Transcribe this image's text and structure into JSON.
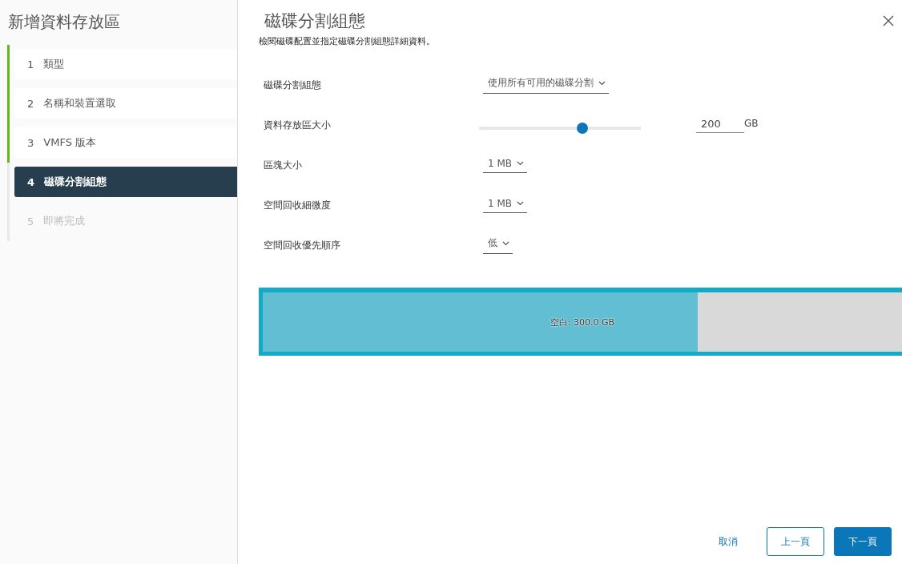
{
  "sidebar": {
    "title": "新增資料存放區",
    "steps": [
      {
        "number": "1",
        "label": "類型",
        "selected": false,
        "done": true,
        "disabled": false
      },
      {
        "number": "2",
        "label": "名稱和裝置選取",
        "selected": false,
        "done": true,
        "disabled": false
      },
      {
        "number": "3",
        "label": "VMFS 版本",
        "selected": false,
        "done": true,
        "disabled": false
      },
      {
        "number": "4",
        "label": "磁碟分割組態",
        "selected": true,
        "done": false,
        "disabled": false
      },
      {
        "number": "5",
        "label": "即將完成",
        "selected": false,
        "done": false,
        "disabled": true
      }
    ]
  },
  "main": {
    "title": "磁碟分割組態",
    "description": "檢閱磁碟配置並指定磁碟分割組態詳細資料。",
    "fields": [
      {
        "kind": "select",
        "label": "磁碟分割組態",
        "value": "使用所有可用的磁碟分割"
      },
      {
        "kind": "slider",
        "label": "資料存放區大小",
        "level": 0.65,
        "value": "200",
        "unit": "GB"
      },
      {
        "kind": "select",
        "label": "區塊大小",
        "value": "1 MB"
      },
      {
        "kind": "select",
        "label": "空間回收細微度",
        "value": "1 MB"
      },
      {
        "kind": "select",
        "label": "空間回收優先順序",
        "value": "低"
      }
    ],
    "partition": {
      "label": "空白: 300.0 GB",
      "level": 0.68
    }
  },
  "buttons": [
    {
      "kind": "link",
      "label": "取消"
    },
    {
      "kind": "outline",
      "label": "上一頁"
    },
    {
      "kind": "primary",
      "label": "下一頁"
    }
  ]
}
